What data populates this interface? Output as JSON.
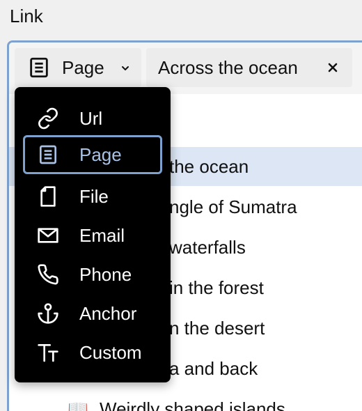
{
  "field": {
    "label": "Link"
  },
  "type_selector": {
    "label": "Page",
    "icon": "page-icon"
  },
  "value_chip": {
    "text": "Across the ocean",
    "clear_icon": "close-icon"
  },
  "dropdown": {
    "items": [
      {
        "label": "Url",
        "icon": "link-icon",
        "active": false
      },
      {
        "label": "Page",
        "icon": "page-icon",
        "active": true
      },
      {
        "label": "File",
        "icon": "file-icon",
        "active": false
      },
      {
        "label": "Email",
        "icon": "envelope-icon",
        "active": false
      },
      {
        "label": "Phone",
        "icon": "phone-icon",
        "active": false
      },
      {
        "label": "Anchor",
        "icon": "anchor-icon",
        "active": false
      },
      {
        "label": "Custom",
        "icon": "text-size-icon",
        "active": false
      }
    ]
  },
  "page_list": {
    "items": [
      {
        "text": "the ocean",
        "selected": true
      },
      {
        "text": "ngle of Sumatra",
        "selected": false
      },
      {
        "text": " waterfalls",
        "selected": false
      },
      {
        "text": "in the forest",
        "selected": false
      },
      {
        "text": "n the desert",
        "selected": false
      },
      {
        "text": "a and back",
        "selected": false
      },
      {
        "text": "Weirdly shaped islands",
        "selected": false,
        "icon": "📖"
      }
    ]
  },
  "colors": {
    "accent": "#7ea2d0",
    "selected_row": "#dce6f4",
    "menu_bg": "#000000",
    "active_text": "#a9c1e5"
  }
}
